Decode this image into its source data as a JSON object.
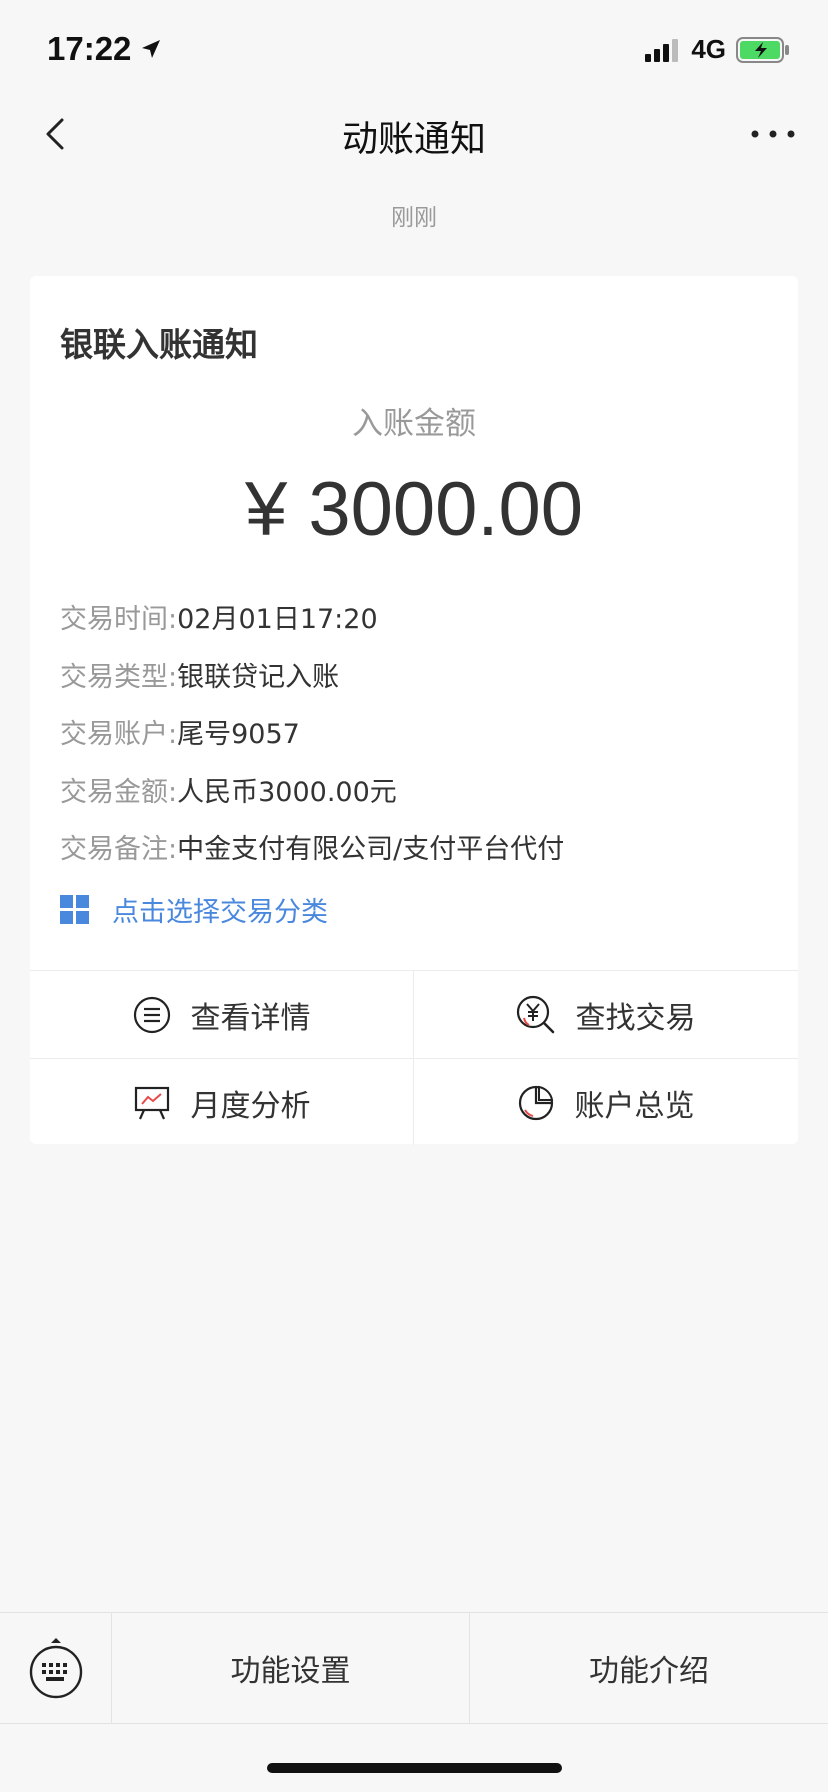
{
  "status_bar": {
    "time": "17:22",
    "network": "4G",
    "icons": [
      "location-arrow-icon",
      "signal-icon",
      "battery-charging-icon"
    ]
  },
  "nav": {
    "title": "动账通知",
    "back_icon": "chevron-left-icon",
    "more_icon": "more-icon"
  },
  "time_label": "刚刚",
  "card": {
    "title": "银联入账通知",
    "amount_label": "入账金额",
    "amount_value": "¥ 3000.00",
    "details": [
      {
        "key": "交易时间:",
        "value": "02月01日17:20"
      },
      {
        "key": "交易类型:",
        "value": "银联贷记入账"
      },
      {
        "key": "交易账户:",
        "value": "尾号9057"
      },
      {
        "key": "交易金额:",
        "value": "人民币3000.00元"
      },
      {
        "key": "交易备注:",
        "value": "中金支付有限公司/支付平台代付"
      }
    ],
    "classify_label": "点击选择交易分类",
    "accent_color": "#4a88de",
    "actions": [
      {
        "label": "查看详情",
        "icon": "list-icon"
      },
      {
        "label": "查找交易",
        "icon": "search-yuan-icon"
      },
      {
        "label": "月度分析",
        "icon": "chart-board-icon"
      },
      {
        "label": "账户总览",
        "icon": "pie-chart-icon"
      }
    ]
  },
  "bottom_bar": {
    "keyboard_icon": "keyboard-icon",
    "buttons": [
      "功能设置",
      "功能介绍"
    ]
  }
}
